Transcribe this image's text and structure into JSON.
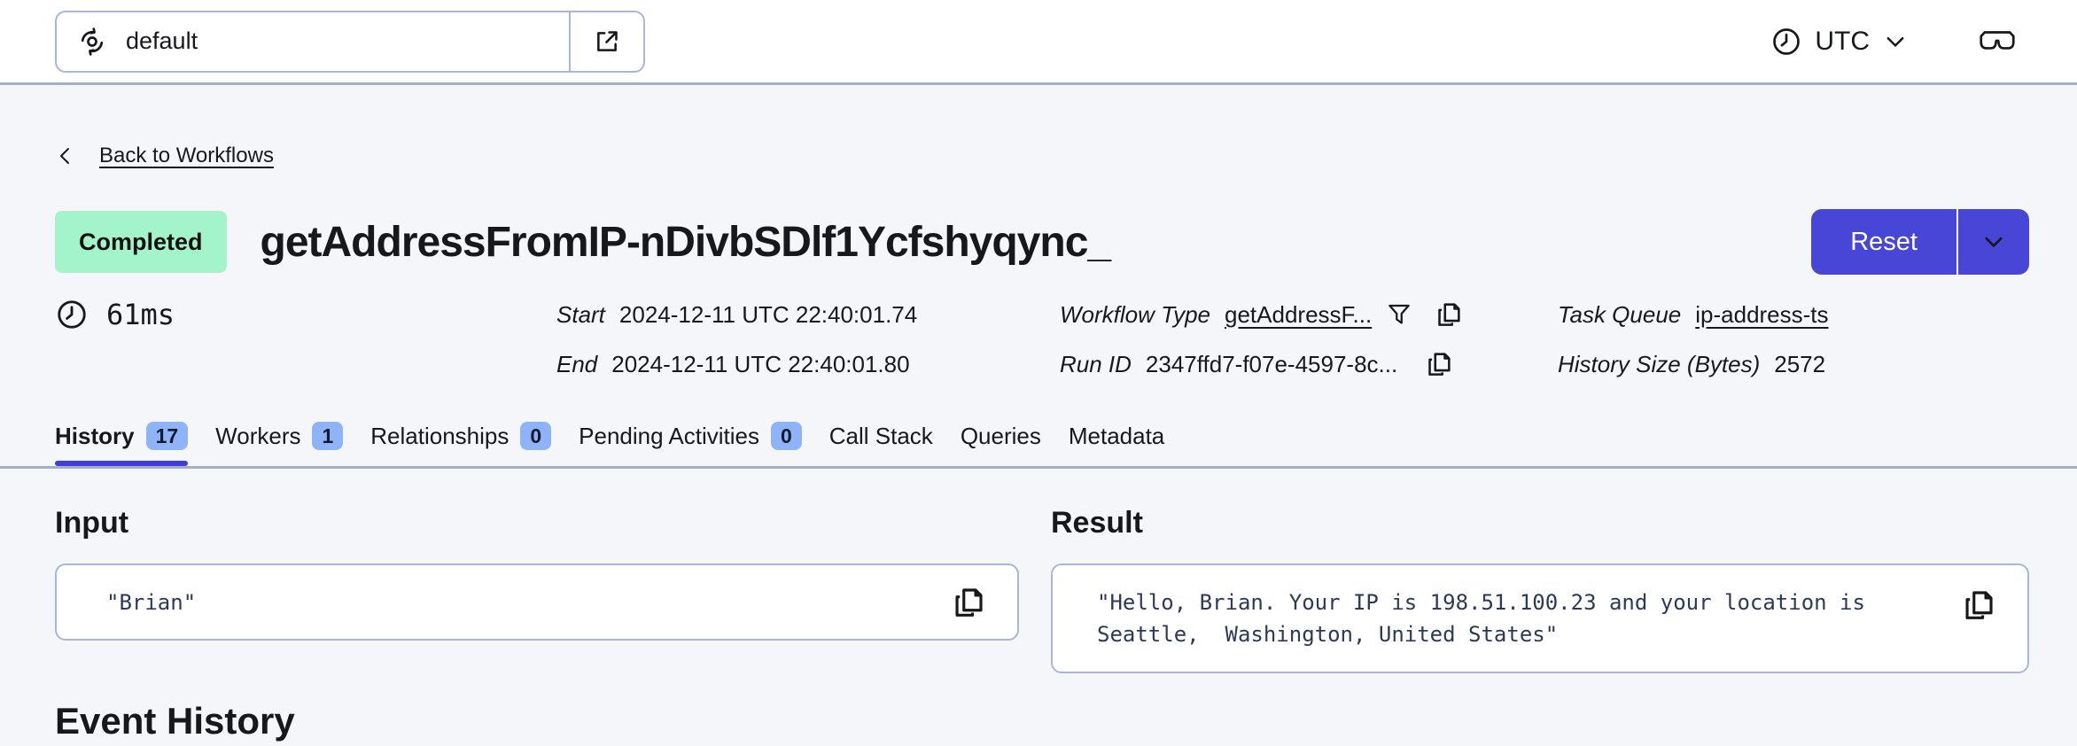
{
  "topbar": {
    "namespace_value": "default",
    "timezone_label": "UTC"
  },
  "header": {
    "back_label": "Back to Workflows",
    "status_label": "Completed",
    "workflow_title": "getAddressFromIP-nDivbSDlf1Ycfshyqync_",
    "reset_label": "Reset",
    "duration": "61ms"
  },
  "meta": {
    "start_label": "Start",
    "start_value": "2024-12-11 UTC 22:40:01.74",
    "end_label": "End",
    "end_value": "2024-12-11 UTC 22:40:01.80",
    "workflow_type_label": "Workflow Type",
    "workflow_type_value": "getAddressF...",
    "run_id_label": "Run ID",
    "run_id_value": "2347ffd7-f07e-4597-8c...",
    "task_queue_label": "Task Queue",
    "task_queue_value": "ip-address-ts",
    "history_size_label": "History Size (Bytes)",
    "history_size_value": "2572"
  },
  "tabs": [
    {
      "label": "History",
      "badge": "17"
    },
    {
      "label": "Workers",
      "badge": "1"
    },
    {
      "label": "Relationships",
      "badge": "0"
    },
    {
      "label": "Pending Activities",
      "badge": "0"
    },
    {
      "label": "Call Stack"
    },
    {
      "label": "Queries"
    },
    {
      "label": "Metadata"
    }
  ],
  "io": {
    "input_title": "Input",
    "input_value": "\"Brian\"",
    "result_title": "Result",
    "result_value": "\"Hello, Brian. Your IP is 198.51.100.23 and your location is Seattle,  Washington, United States\""
  },
  "sections": {
    "event_history_title": "Event History"
  },
  "icons": {
    "namespace": "namespace-cycle-icon",
    "open_in_new": "external-link-icon",
    "clock": "clock-icon",
    "chevron_down": "chevron-down-icon",
    "labs_mode": "glasses-icon",
    "back": "chevron-left-icon",
    "filter": "filter-funnel-icon",
    "copy": "copy-icon"
  },
  "colors": {
    "accent": "#4746D6",
    "tab_underline": "#3F40D3",
    "status_bg": "#A3F4CA",
    "badge_bg": "#8FB3F8",
    "page_bg": "#F5F6FA",
    "card_border": "#A8B7D8",
    "divider": "#A4AFC4",
    "mono_text": "#2C3A58"
  }
}
